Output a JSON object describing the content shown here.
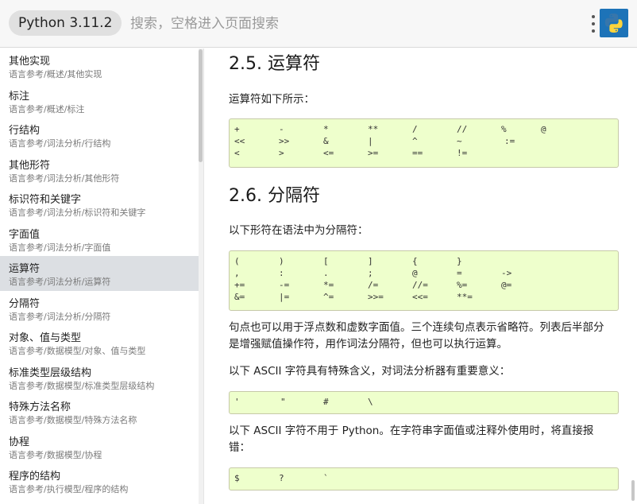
{
  "header": {
    "version": "Python 3.11.2",
    "search_placeholder": "搜索，空格进入页面搜索"
  },
  "sidebar": {
    "items": [
      {
        "title": "其他实现",
        "path": "语言参考/概述/其他实现"
      },
      {
        "title": "标注",
        "path": "语言参考/概述/标注"
      },
      {
        "title": "行结构",
        "path": "语言参考/词法分析/行结构"
      },
      {
        "title": "其他形符",
        "path": "语言参考/词法分析/其他形符"
      },
      {
        "title": "标识符和关键字",
        "path": "语言参考/词法分析/标识符和关键字"
      },
      {
        "title": "字面值",
        "path": "语言参考/词法分析/字面值"
      },
      {
        "title": "运算符",
        "path": "语言参考/词法分析/运算符"
      },
      {
        "title": "分隔符",
        "path": "语言参考/词法分析/分隔符"
      },
      {
        "title": "对象、值与类型",
        "path": "语言参考/数据模型/对象、值与类型"
      },
      {
        "title": "标准类型层级结构",
        "path": "语言参考/数据模型/标准类型层级结构"
      },
      {
        "title": "特殊方法名称",
        "path": "语言参考/数据模型/特殊方法名称"
      },
      {
        "title": "协程",
        "path": "语言参考/数据模型/协程"
      },
      {
        "title": "程序的结构",
        "path": "语言参考/执行模型/程序的结构"
      }
    ],
    "active_index": 6
  },
  "content": {
    "operators_heading": "2.5. 运算符",
    "operators_intro": "运算符如下所示：",
    "operators_code": [
      [
        "+",
        "-",
        "*",
        "**",
        "/",
        "//",
        "%",
        "@"
      ],
      [
        "<<",
        ">>",
        "&",
        "|",
        "^",
        "~",
        ":="
      ],
      [
        "<",
        ">",
        "<=",
        ">=",
        "==",
        "!="
      ]
    ],
    "delimiters_heading": "2.6. 分隔符",
    "delimiters_intro": "以下形符在语法中为分隔符：",
    "delimiters_code": [
      [
        "(",
        ")",
        "[",
        "]",
        "{",
        "}"
      ],
      [
        ",",
        ":",
        ".",
        ";",
        "@",
        "=",
        "->"
      ],
      [
        "+=",
        "-=",
        "*=",
        "/=",
        "//=",
        "%=",
        "@="
      ],
      [
        "&=",
        "|=",
        "^=",
        ">>=",
        "<<=",
        "**="
      ]
    ],
    "period_note_line1": "句点也可以用于浮点数和虚数字面值。三个连续句点表示省略符。列表后半部分",
    "period_note_line2": "是增强赋值操作符，用作词法分隔符，但也可以执行运算。",
    "ascii_special_intro": "以下 ASCII 字符具有特殊含义，对词法分析器有重要意义：",
    "ascii_special_code": [
      "'",
      "\"",
      "#",
      "\\"
    ],
    "ascii_unused_line1": "以下 ASCII 字符不用于 Python。在字符串字面值或注释外使用时，将直接报",
    "ascii_unused_line2": "错：",
    "ascii_unused_code": [
      "$",
      "?",
      "`"
    ]
  },
  "icons": {
    "menu": "vertical-dots-icon",
    "logo": "python-logo-icon"
  },
  "colors": {
    "code_background": "#eeffcc",
    "active_sidebar": "#dcdfe3",
    "python_blue": "#3776ab",
    "python_yellow": "#ffd43b"
  }
}
